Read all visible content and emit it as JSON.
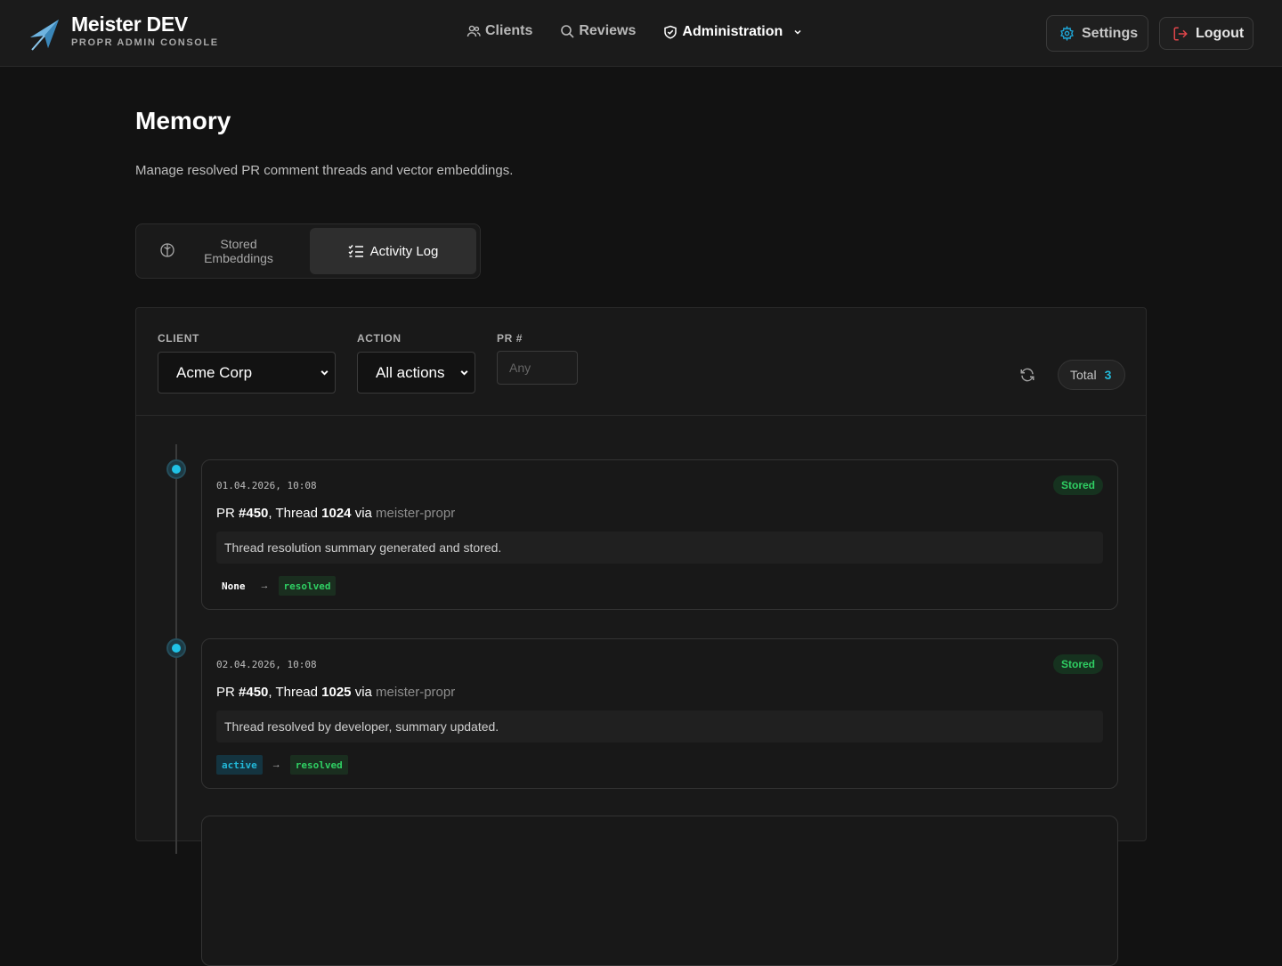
{
  "brand": {
    "name": "Meister DEV",
    "subtitle": "PROPR ADMIN CONSOLE"
  },
  "nav": {
    "clients": "Clients",
    "reviews": "Reviews",
    "administration": "Administration"
  },
  "header_buttons": {
    "settings": "Settings",
    "logout": "Logout"
  },
  "page": {
    "title": "Memory",
    "subtitle": "Manage resolved PR comment threads and vector embeddings."
  },
  "tabs": {
    "stored": "Stored Embeddings",
    "activity": "Activity Log"
  },
  "filters": {
    "client_label": "CLIENT",
    "client_value": "Acme Corp",
    "action_label": "ACTION",
    "action_value": "All actions",
    "pr_label": "PR #",
    "pr_placeholder": "Any",
    "total_label": "Total",
    "total_value": "3"
  },
  "entries": [
    {
      "timestamp": "01.04.2026, 10:08",
      "badge": "Stored",
      "pr_prefix": "PR ",
      "pr": "#450",
      "thread_prefix": ", Thread ",
      "thread": "1024",
      "via": " via ",
      "source": "meister-propr",
      "summary": "Thread resolution summary generated and stored.",
      "from": "None",
      "arrow": "→",
      "to": "resolved"
    },
    {
      "timestamp": "02.04.2026, 10:08",
      "badge": "Stored",
      "pr_prefix": "PR ",
      "pr": "#450",
      "thread_prefix": ", Thread ",
      "thread": "1025",
      "via": " via ",
      "source": "meister-propr",
      "summary": "Thread resolved by developer, summary updated.",
      "from": "active",
      "arrow": "→",
      "to": "resolved"
    }
  ],
  "colors": {
    "accent": "#20c2e6",
    "success": "#2fcf63",
    "background": "#121212"
  }
}
